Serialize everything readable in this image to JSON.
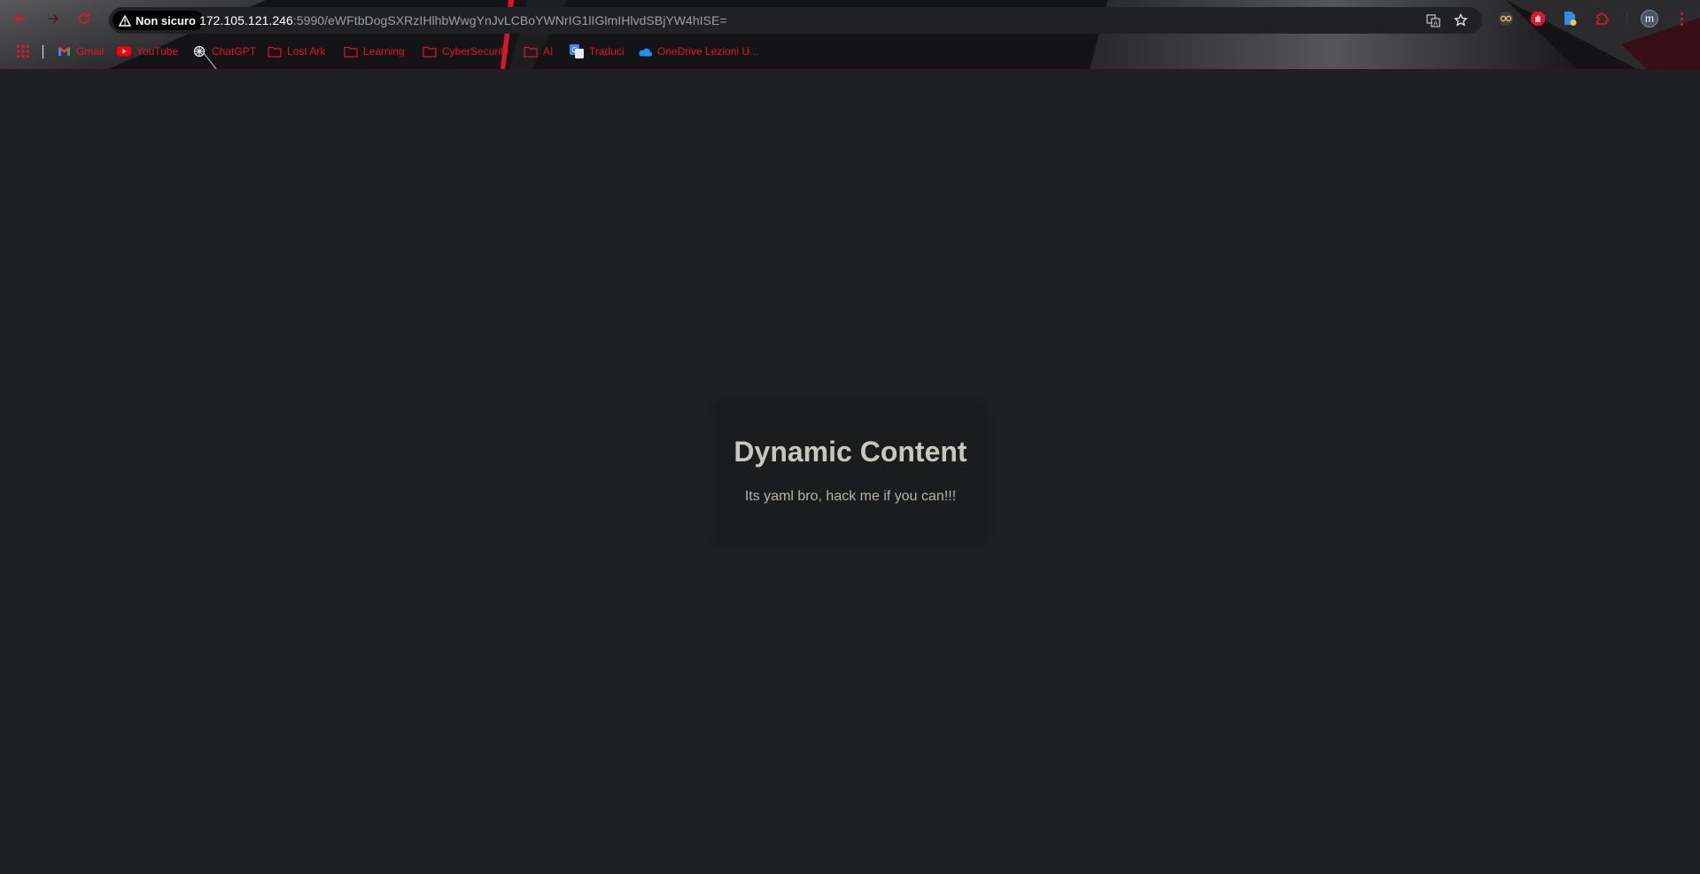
{
  "browser": {
    "security_label": "Non sicuro",
    "url_host": "172.105.121.246",
    "url_rest": ":5990/eWFtbDogSXRzIHlhbWwgYnJvLCBoYWNrIG1lIGlmIHlvdSBjYW4hISE=",
    "avatar_initial": "m",
    "accent_color": "#e0152d"
  },
  "bookmarks": [
    {
      "label": "Gmail",
      "icon": "gmail-icon"
    },
    {
      "label": "YouTube",
      "icon": "youtube-icon"
    },
    {
      "label": "ChatGPT",
      "icon": "chatgpt-icon"
    },
    {
      "label": "Lost Ark",
      "icon": "folder-icon"
    },
    {
      "label": "Learning",
      "icon": "folder-icon"
    },
    {
      "label": "CyberSecurity",
      "icon": "folder-icon"
    },
    {
      "label": "AI",
      "icon": "folder-icon"
    },
    {
      "label": "Traduci",
      "icon": "google-translate-icon"
    },
    {
      "label": "OneDrive Lezioni U...",
      "icon": "onedrive-icon"
    }
  ],
  "page": {
    "title": "Dynamic Content",
    "message": "Its yaml bro, hack me if you can!!!"
  }
}
